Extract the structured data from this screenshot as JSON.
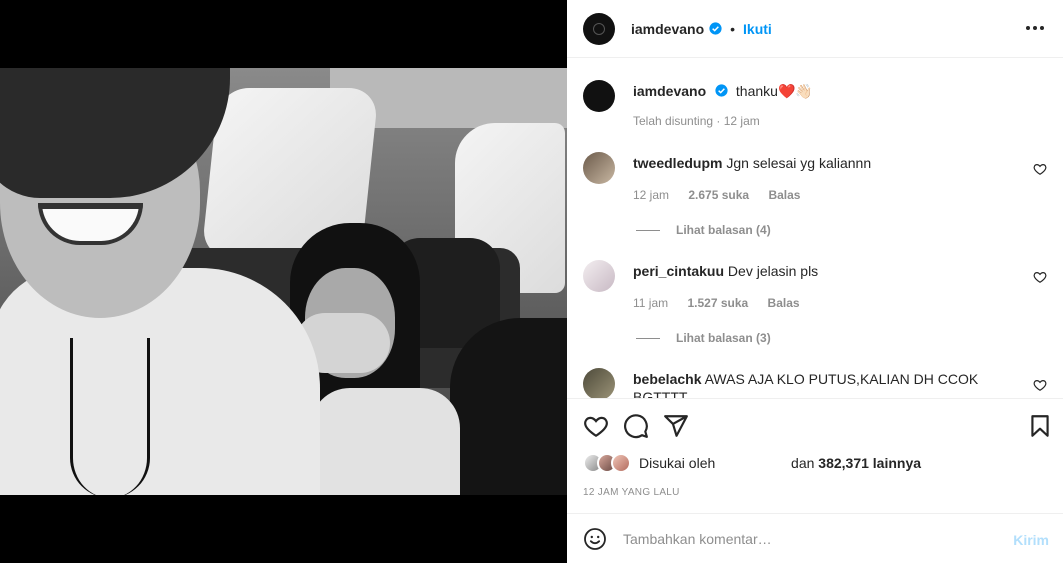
{
  "post": {
    "author": "iamdevano",
    "follow_label": "Ikuti",
    "separator": "•",
    "verified_color": "#0095f6"
  },
  "caption": {
    "username": "iamdevano",
    "text": "thanku❤️👋🏻",
    "meta": "Telah disunting · 12 jam"
  },
  "comments": [
    {
      "username": "tweedledupm",
      "text": "Jgn selesai yg kaliannn",
      "time": "12 jam",
      "likes": "2.675 suka",
      "reply": "Balas",
      "view_replies": "Lihat balasan (4)"
    },
    {
      "username": "peri_cintakuu",
      "text": "Dev jelasin pls",
      "time": "11 jam",
      "likes": "1.527 suka",
      "reply": "Balas",
      "view_replies": "Lihat balasan (3)"
    },
    {
      "username": "bebelachk",
      "text": "AWAS AJA KLO PUTUS,KALIAN DH CCOK BGTTTT"
    }
  ],
  "likes": {
    "prefix": "Disukai oleh",
    "middle": "dan",
    "count": "382,371 lainnya"
  },
  "timestamp": "12 JAM YANG LALU",
  "composer": {
    "placeholder": "Tambahkan komentar…",
    "post_label": "Kirim"
  },
  "icons": {
    "like": "heart-icon",
    "comment": "comment-icon",
    "share": "share-icon",
    "save": "bookmark-icon",
    "more": "more-icon",
    "emoji": "emoji-icon"
  },
  "colors": {
    "link": "#0095f6",
    "muted": "#8e8e8e",
    "post_disabled": "#b2dffc"
  }
}
